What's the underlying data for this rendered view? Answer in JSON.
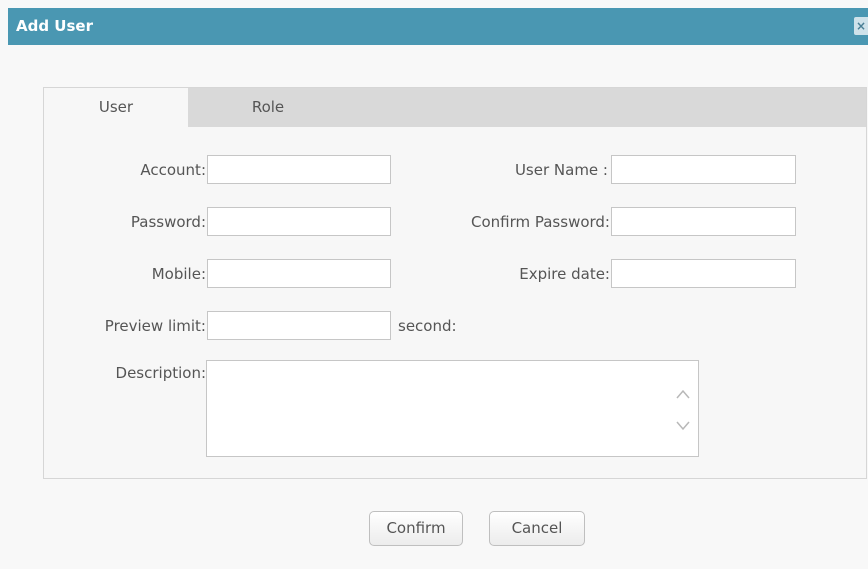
{
  "dialog": {
    "title": "Add User",
    "close_label": "×"
  },
  "tabs": [
    {
      "label": "User",
      "active": true
    },
    {
      "label": "Role",
      "active": false
    }
  ],
  "form": {
    "account_label": "Account:",
    "account_value": "",
    "username_label": "User Name :",
    "username_value": "",
    "password_label": "Password:",
    "password_value": "",
    "confirm_password_label": "Confirm Password:",
    "confirm_password_value": "",
    "mobile_label": "Mobile:",
    "mobile_value": "",
    "expire_date_label": "Expire date:",
    "expire_date_value": "",
    "preview_limit_label": "Preview limit:",
    "preview_limit_value": "",
    "preview_limit_unit": "second:",
    "description_label": "Description:",
    "description_value": ""
  },
  "buttons": {
    "confirm": "Confirm",
    "cancel": "Cancel"
  },
  "icons": {
    "close": "close-icon",
    "scroll_up": "chevron-up-icon",
    "scroll_down": "chevron-down-icon"
  },
  "colors": {
    "titlebar": "#4a97b2",
    "tabbar": "#d9d9d9"
  }
}
